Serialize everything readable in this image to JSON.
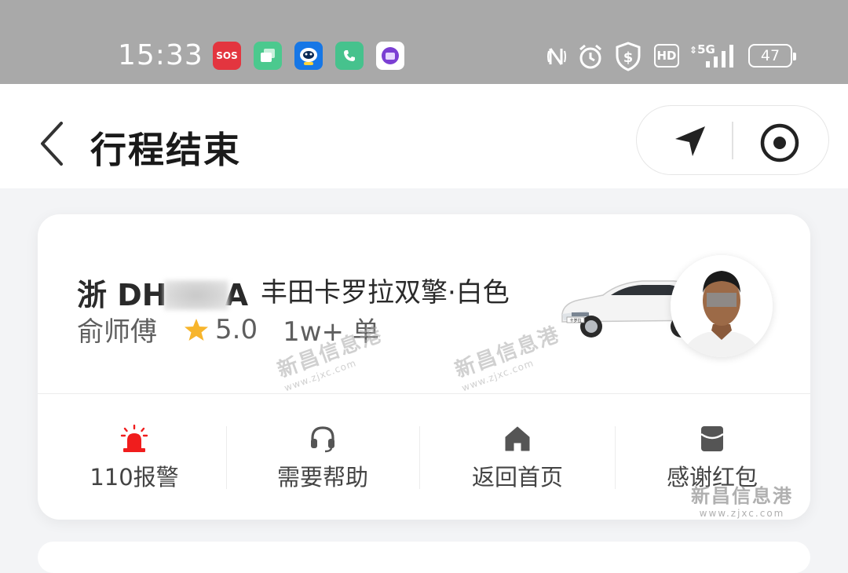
{
  "status_bar": {
    "time": "15:33",
    "apps": [
      {
        "icon": "sos-app-icon",
        "label": "SOS",
        "color": "#e3353f"
      },
      {
        "icon": "multitask-app-icon",
        "label": "",
        "color": "#4bc98e"
      },
      {
        "icon": "robot-app-icon",
        "label": "",
        "color": "#1677e6"
      },
      {
        "icon": "phone-app-icon",
        "label": "",
        "color": "#46c28d"
      },
      {
        "icon": "purple-app-icon",
        "label": "",
        "color": "#ffffff"
      }
    ],
    "network": "5G",
    "hd_label": "HD",
    "battery": "47"
  },
  "header": {
    "title": "行程结束"
  },
  "trip_card": {
    "plate_prefix": "浙 DH",
    "plate_suffix": "A",
    "car_model": "丰田卡罗拉双擎·白色",
    "driver_name": "俞师傅",
    "rating": "5.0",
    "trips": "1w+ 单",
    "car_plate_sign": "卡罗拉",
    "actions": [
      {
        "label": "110报警",
        "icon": "alarm-icon",
        "color": "#f01d1d"
      },
      {
        "label": "需要帮助",
        "icon": "headset-icon",
        "color": "#555555"
      },
      {
        "label": "返回首页",
        "icon": "home-icon",
        "color": "#555555"
      },
      {
        "label": "感谢红包",
        "icon": "red-envelope-icon",
        "color": "#555555"
      }
    ]
  },
  "watermarks": {
    "brand": "新昌信息港",
    "url": "www.zjxc.com"
  },
  "colors": {
    "status_bar_bg": "#a9a9a9",
    "page_bg": "#f3f4f6",
    "star": "#f7b52c",
    "alarm_red": "#f01d1d"
  }
}
